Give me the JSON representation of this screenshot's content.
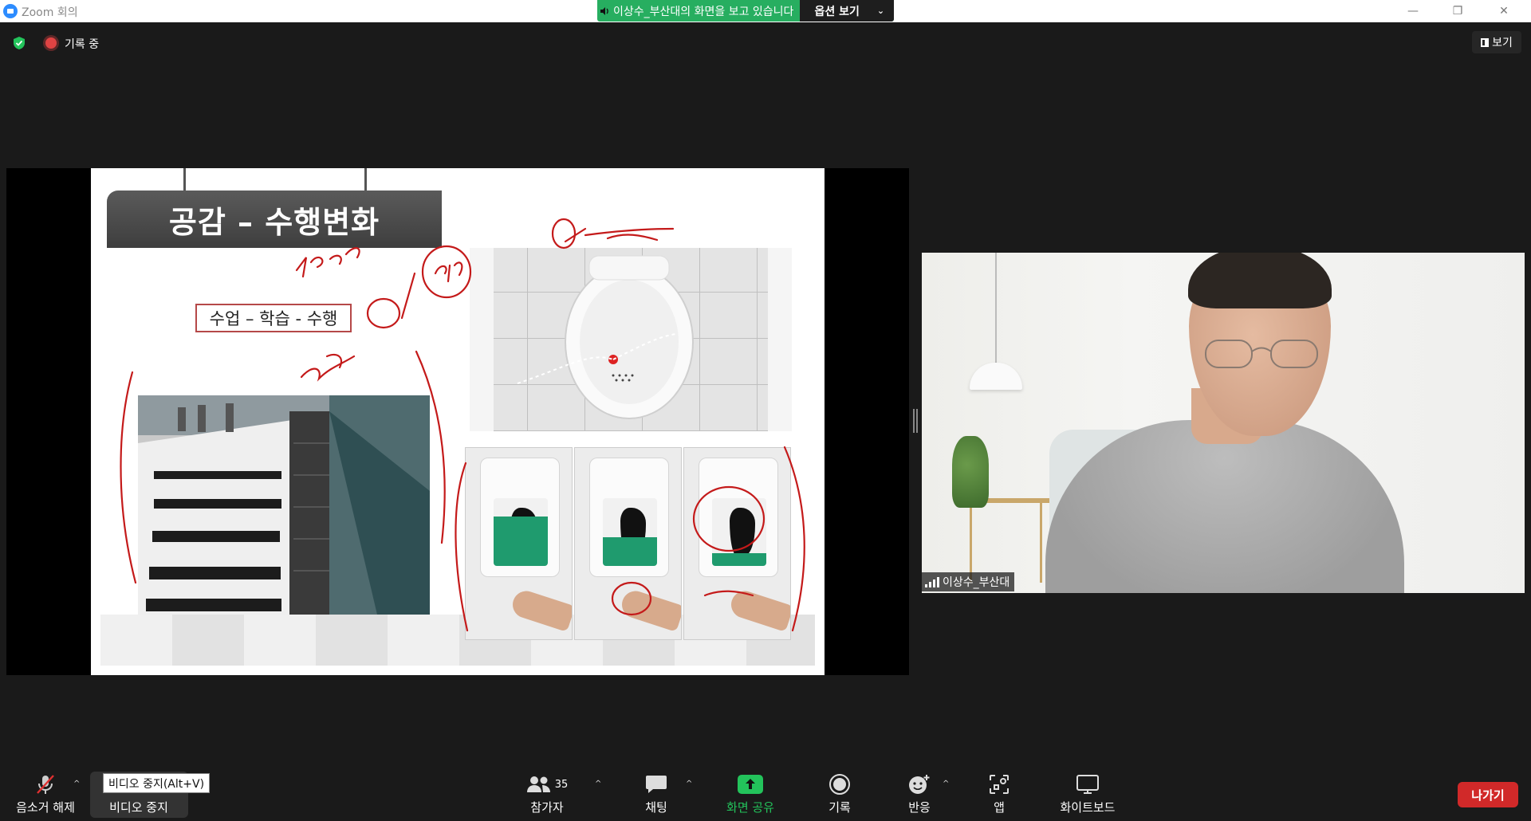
{
  "window": {
    "title": "Zoom 회의",
    "controls": {
      "minimize": "—",
      "restore": "❐",
      "close": "✕"
    }
  },
  "share_banner": {
    "text": "이상수_부산대의 화면을 보고 있습니다",
    "options_label": "옵션 보기"
  },
  "top_bar": {
    "recording_label": "기록 중",
    "view_label": "보기"
  },
  "slide": {
    "title": "공감 – 수행변화",
    "tag": "수업 – 학습 - 수행"
  },
  "participant": {
    "name": "이상수_부산대"
  },
  "toolbar": {
    "mute_label": "음소거 해제",
    "video_label": "비디오 중지",
    "video_tooltip": "비디오 중지(Alt+V)",
    "participants_label": "참가자",
    "participants_count": "35",
    "chat_label": "채팅",
    "share_label": "화면 공유",
    "record_label": "기록",
    "reactions_label": "반응",
    "apps_label": "앱",
    "whiteboard_label": "화이트보드",
    "leave_label": "나가기"
  },
  "colors": {
    "share_green": "#27ae60",
    "leave_red": "#d12929",
    "accent_blue": "#2d8cff",
    "annotation_red": "#c41a1a"
  }
}
